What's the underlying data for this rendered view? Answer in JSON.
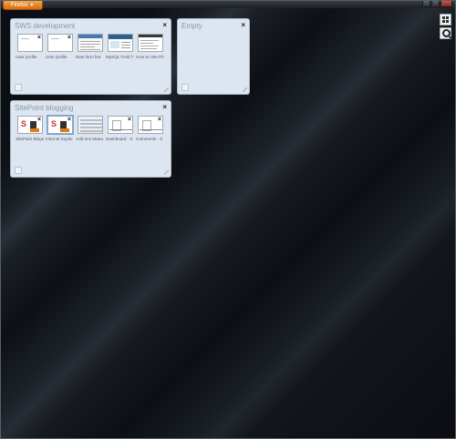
{
  "browser": {
    "app_menu_label": "Firefox",
    "app_menu_icon": "chevron-down-icon"
  },
  "toolbar": {
    "group_icon": "grid-icon",
    "search_icon": "search-icon"
  },
  "groups": [
    {
      "title": "SWS development",
      "close": "×",
      "tabs": [
        {
          "label": "User profile",
          "thumb": "blank"
        },
        {
          "label": "User profile",
          "thumb": "blank"
        },
        {
          "label": "New form fea",
          "thumb": "news"
        },
        {
          "label": "MySQL Field T",
          "thumb": "mysql"
        },
        {
          "label": "How to Use Ph",
          "thumb": "howto"
        }
      ]
    },
    {
      "title": "Empty",
      "close": "×",
      "tabs": []
    },
    {
      "title": "SitePoint blogging",
      "close": "×",
      "tabs": [
        {
          "label": "SitePoint Blogs",
          "thumb": "sp"
        },
        {
          "label": "Internet Explor",
          "thumb": "sp",
          "active": true
        },
        {
          "label": "Add-ons Mana",
          "thumb": "addon"
        },
        {
          "label": "Dashboard - S",
          "thumb": "dash"
        },
        {
          "label": "Comments - S",
          "thumb": "dash"
        }
      ]
    }
  ],
  "colors": {
    "app_button": "#e07a1a",
    "group_bg": "#dde6f0",
    "active_outline": "#6aa8e0"
  }
}
